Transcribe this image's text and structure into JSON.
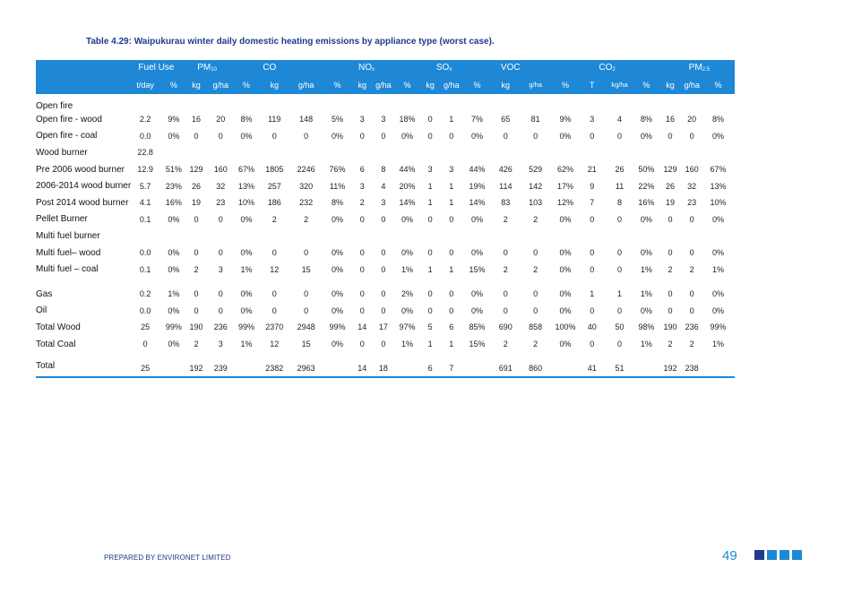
{
  "caption": "Table 4.29: Waipukurau winter daily domestic heating emissions by appliance type (worst case).",
  "header_groups": [
    {
      "label": "Fuel Use",
      "sub": ""
    },
    {
      "label": "PM",
      "sub": "10"
    },
    {
      "label": "CO",
      "sub": ""
    },
    {
      "label": "NO",
      "sub": "x"
    },
    {
      "label": "SO",
      "sub": "x"
    },
    {
      "label": "VOC",
      "sub": ""
    },
    {
      "label": "CO",
      "sub": "2"
    },
    {
      "label": "PM",
      "sub": "2.5"
    }
  ],
  "columns": [
    "t/day",
    "%",
    "kg",
    "g/ha",
    "%",
    "kg",
    "g/ha",
    "%",
    "kg",
    "g/ha",
    "%",
    "kg",
    "g/ha",
    "%",
    "kg",
    "g/ha",
    "%",
    "T",
    "kg/ha",
    "%",
    "kg",
    "g/ha",
    "%"
  ],
  "rows": [
    {
      "label": "Open fire",
      "cells": [
        "",
        "",
        "",
        "",
        "",
        "",
        "",
        "",
        "",
        "",
        "",
        "",
        "",
        "",
        "",
        "",
        "",
        "",
        "",
        "",
        "",
        "",
        ""
      ]
    },
    {
      "label": "Open fire - wood",
      "cells": [
        "2.2",
        "9%",
        "16",
        "20",
        "8%",
        "119",
        "148",
        "5%",
        "3",
        "3",
        "18%",
        "0",
        "1",
        "7%",
        "65",
        "81",
        "9%",
        "3",
        "4",
        "8%",
        "16",
        "20",
        "8%"
      ]
    },
    {
      "label": "Open fire - coal",
      "cells": [
        "0.0",
        "0%",
        "0",
        "0",
        "0%",
        "0",
        "0",
        "0%",
        "0",
        "0",
        "0%",
        "0",
        "0",
        "0%",
        "0",
        "0",
        "0%",
        "0",
        "0",
        "0%",
        "0",
        "0",
        "0%"
      ]
    },
    {
      "label": "Wood burner",
      "cells": [
        "22.8",
        "",
        "",
        "",
        "",
        "",
        "",
        "",
        "",
        "",
        "",
        "",
        "",
        "",
        "",
        "",
        "",
        "",
        "",
        "",
        "",
        "",
        ""
      ]
    },
    {
      "label": "Pre 2006 wood burner",
      "cells": [
        "12.9",
        "51%",
        "129",
        "160",
        "67%",
        "1805",
        "2246",
        "76%",
        "6",
        "8",
        "44%",
        "3",
        "3",
        "44%",
        "426",
        "529",
        "62%",
        "21",
        "26",
        "50%",
        "129",
        "160",
        "67%"
      ]
    },
    {
      "label": "2006-2014 wood burner",
      "cells": [
        "5.7",
        "23%",
        "26",
        "32",
        "13%",
        "257",
        "320",
        "11%",
        "3",
        "4",
        "20%",
        "1",
        "1",
        "19%",
        "114",
        "142",
        "17%",
        "9",
        "11",
        "22%",
        "26",
        "32",
        "13%"
      ]
    },
    {
      "label": "Post 2014 wood burner",
      "cells": [
        "4.1",
        "16%",
        "19",
        "23",
        "10%",
        "186",
        "232",
        "8%",
        "2",
        "3",
        "14%",
        "1",
        "1",
        "14%",
        "83",
        "103",
        "12%",
        "7",
        "8",
        "16%",
        "19",
        "23",
        "10%"
      ]
    },
    {
      "label": "Pellet Burner",
      "cells": [
        "0.1",
        "0%",
        "0",
        "0",
        "0%",
        "2",
        "2",
        "0%",
        "0",
        "0",
        "0%",
        "0",
        "0",
        "0%",
        "2",
        "2",
        "0%",
        "0",
        "0",
        "0%",
        "0",
        "0",
        "0%"
      ]
    },
    {
      "label": "Multi fuel burner",
      "cells": [
        "",
        "",
        "",
        "",
        "",
        "",
        "",
        "",
        "",
        "",
        "",
        "",
        "",
        "",
        "",
        "",
        "",
        "",
        "",
        "",
        "",
        "",
        ""
      ]
    },
    {
      "label": "Multi fuel– wood",
      "cells": [
        "0.0",
        "0%",
        "0",
        "0",
        "0%",
        "0",
        "0",
        "0%",
        "0",
        "0",
        "0%",
        "0",
        "0",
        "0%",
        "0",
        "0",
        "0%",
        "0",
        "0",
        "0%",
        "0",
        "0",
        "0%"
      ]
    },
    {
      "label": "Multi fuel – coal",
      "cells": [
        "0.1",
        "0%",
        "2",
        "3",
        "1%",
        "12",
        "15",
        "0%",
        "0",
        "0",
        "1%",
        "1",
        "1",
        "15%",
        "2",
        "2",
        "0%",
        "0",
        "0",
        "1%",
        "2",
        "2",
        "1%"
      ]
    },
    {
      "label": "Gas",
      "cells": [
        "0.2",
        "1%",
        "0",
        "0",
        "0%",
        "0",
        "0",
        "0%",
        "0",
        "0",
        "2%",
        "0",
        "0",
        "0%",
        "0",
        "0",
        "0%",
        "1",
        "1",
        "1%",
        "0",
        "0",
        "0%"
      ]
    },
    {
      "label": "Oil",
      "cells": [
        "0.0",
        "0%",
        "0",
        "0",
        "0%",
        "0",
        "0",
        "0%",
        "0",
        "0",
        "0%",
        "0",
        "0",
        "0%",
        "0",
        "0",
        "0%",
        "0",
        "0",
        "0%",
        "0",
        "0",
        "0%"
      ]
    },
    {
      "label": "Total Wood",
      "cells": [
        "25",
        "99%",
        "190",
        "236",
        "99%",
        "2370",
        "2948",
        "99%",
        "14",
        "17",
        "97%",
        "5",
        "6",
        "85%",
        "690",
        "858",
        "100%",
        "40",
        "50",
        "98%",
        "190",
        "236",
        "99%"
      ]
    },
    {
      "label": "Total Coal",
      "cells": [
        "0",
        "0%",
        "2",
        "3",
        "1%",
        "12",
        "15",
        "0%",
        "0",
        "0",
        "1%",
        "1",
        "1",
        "15%",
        "2",
        "2",
        "0%",
        "0",
        "0",
        "1%",
        "2",
        "2",
        "1%"
      ]
    }
  ],
  "total_row": {
    "label": "Total",
    "cells": [
      "25",
      "",
      "192",
      "239",
      "",
      "2382",
      "2963",
      "",
      "14",
      "18",
      "",
      "6",
      "7",
      "",
      "691",
      "860",
      "",
      "41",
      "51",
      "",
      "192",
      "238",
      ""
    ]
  },
  "footer": {
    "prepared_by": "PREPARED BY ENVIRONET LIMITED",
    "page_number": "49"
  },
  "colors": {
    "header_blue": "#1e88d6",
    "caption_navy": "#1f3a8a"
  }
}
